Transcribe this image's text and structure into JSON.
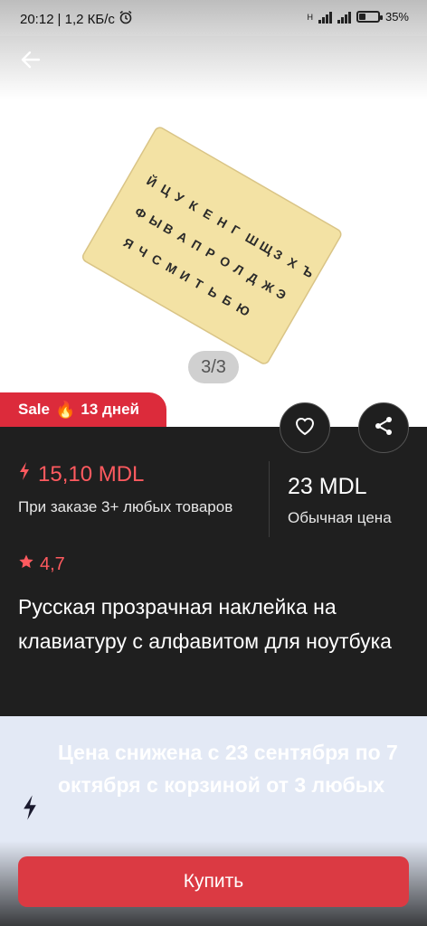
{
  "status_bar": {
    "time": "20:12",
    "speed": "| 1,2 КБ/с",
    "network_label": "H",
    "battery": "35%",
    "battery_level": 0.35
  },
  "gallery": {
    "counter": "3/3",
    "keys_rows": [
      [
        "Й",
        "Ц",
        "У",
        "К",
        "Е",
        "Н",
        "Г",
        "Ш",
        "Щ",
        "З",
        "Х",
        "Ъ"
      ],
      [
        "Ф",
        "Ы",
        "В",
        "А",
        "П",
        "Р",
        "О",
        "Л",
        "Д",
        "Ж",
        "Э"
      ],
      [
        "Я",
        "Ч",
        "С",
        "М",
        "И",
        "Т",
        "Ь",
        "Б",
        "Ю"
      ]
    ]
  },
  "sale_badge": {
    "label": "Sale",
    "flame": "🔥",
    "days": "13 дней"
  },
  "price": {
    "current": "15,10 MDL",
    "note": "При заказе 3+ любых товаров",
    "regular": "23 MDL",
    "regular_label": "Обычная цена"
  },
  "rating": "4,7",
  "title": "Русская прозрачная наклейка на клавиатуру с алфавитом для ноутбука",
  "promo": {
    "text": "Цена снижена с 23 сентября по 7 октября с корзиной от 3 любых"
  },
  "buy_button": "Купить",
  "colors": {
    "accent_red": "#dc2b3b",
    "price_red": "#ff5a5f",
    "dark_panel": "#1f1f1f",
    "promo_bg": "#e3e9f5"
  }
}
